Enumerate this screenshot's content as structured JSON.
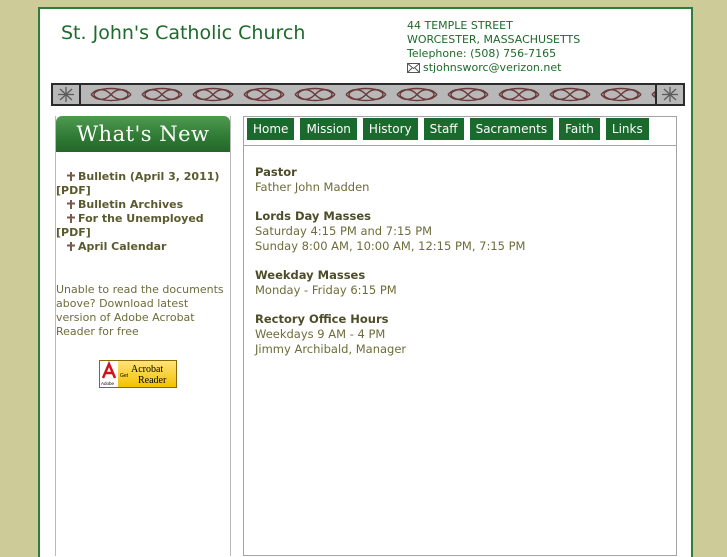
{
  "header": {
    "title": "St. John's Catholic Church",
    "address_line1": "44 TEMPLE STREET",
    "address_line2": "WORCESTER, MASSACHUSETTS",
    "telephone": "Telephone:  (508) 756-7165",
    "email": "stjohnsworc@verizon.net",
    "email_icon": "envelope-icon"
  },
  "colors": {
    "brand_green": "#1a6a2e",
    "page_background": "#cdcb98",
    "text_olive": "#6e6c3a"
  },
  "sidebar": {
    "heading": "What's New",
    "documents": [
      {
        "label": "Bulletin (April 3, 2011)  [PDF]"
      },
      {
        "label": "Bulletin Archives"
      },
      {
        "label": "For the Unemployed  [PDF]"
      },
      {
        "label": "April Calendar"
      }
    ],
    "reader_note": "Unable to read the documents   above? Download latest version of   Adobe Acrobat Reader for free",
    "acrobat_badge": {
      "brand": "Adobe",
      "get": "Get",
      "product_line1": "Acrobat",
      "product_line2": "Reader"
    }
  },
  "nav": {
    "tabs": [
      "Home",
      "Mission",
      "History",
      "Staff",
      "Sacraments",
      "Faith",
      "Links"
    ]
  },
  "content": {
    "sections": [
      {
        "heading": "Pastor",
        "lines": [
          "Father John Madden"
        ]
      },
      {
        "heading": "Lords Day Masses",
        "lines": [
          "Saturday 4:15 PM and 7:15 PM",
          "Sunday 8:00 AM, 10:00 AM, 12:15 PM, 7:15 PM"
        ]
      },
      {
        "heading": "Weekday Masses",
        "lines": [
          "Monday - Friday 6:15 PM"
        ]
      },
      {
        "heading": "Rectory Office Hours",
        "lines": [
          "Weekdays 9 AM - 4 PM",
          "Jimmy Archibald, Manager"
        ]
      }
    ]
  }
}
